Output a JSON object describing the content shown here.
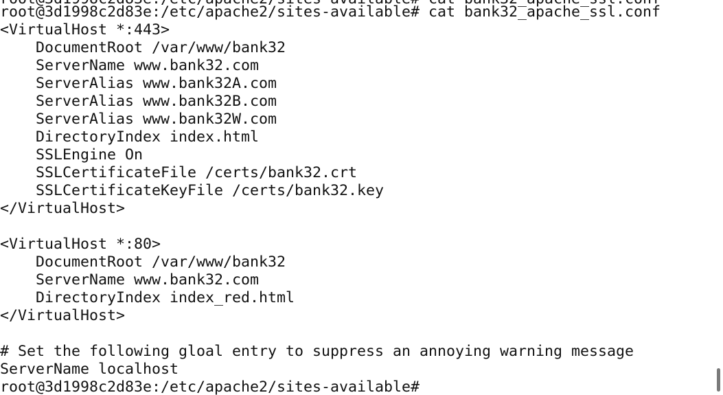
{
  "terminal": {
    "cropped_line": "root@3d1998c2d83e:/etc/apache2/sites-available# cat bank32_apache_ssl.conf",
    "lines": [
      "root@3d1998c2d83e:/etc/apache2/sites-available# cat bank32_apache_ssl.conf",
      "<VirtualHost *:443>",
      "    DocumentRoot /var/www/bank32",
      "    ServerName www.bank32.com",
      "    ServerAlias www.bank32A.com",
      "    ServerAlias www.bank32B.com",
      "    ServerAlias www.bank32W.com",
      "    DirectoryIndex index.html",
      "    SSLEngine On",
      "    SSLCertificateFile /certs/bank32.crt",
      "    SSLCertificateKeyFile /certs/bank32.key",
      "</VirtualHost>",
      "",
      "<VirtualHost *:80>",
      "    DocumentRoot /var/www/bank32",
      "    ServerName www.bank32.com",
      "    DirectoryIndex index_red.html",
      "</VirtualHost>",
      "",
      "# Set the following gloal entry to suppress an annoying warning message",
      "ServerName localhost",
      "root@3d1998c2d83e:/etc/apache2/sites-available#"
    ]
  },
  "colors": {
    "background": "#ffffff",
    "text": "#111111",
    "scrollbar_thumb": "#7a7a7a"
  }
}
